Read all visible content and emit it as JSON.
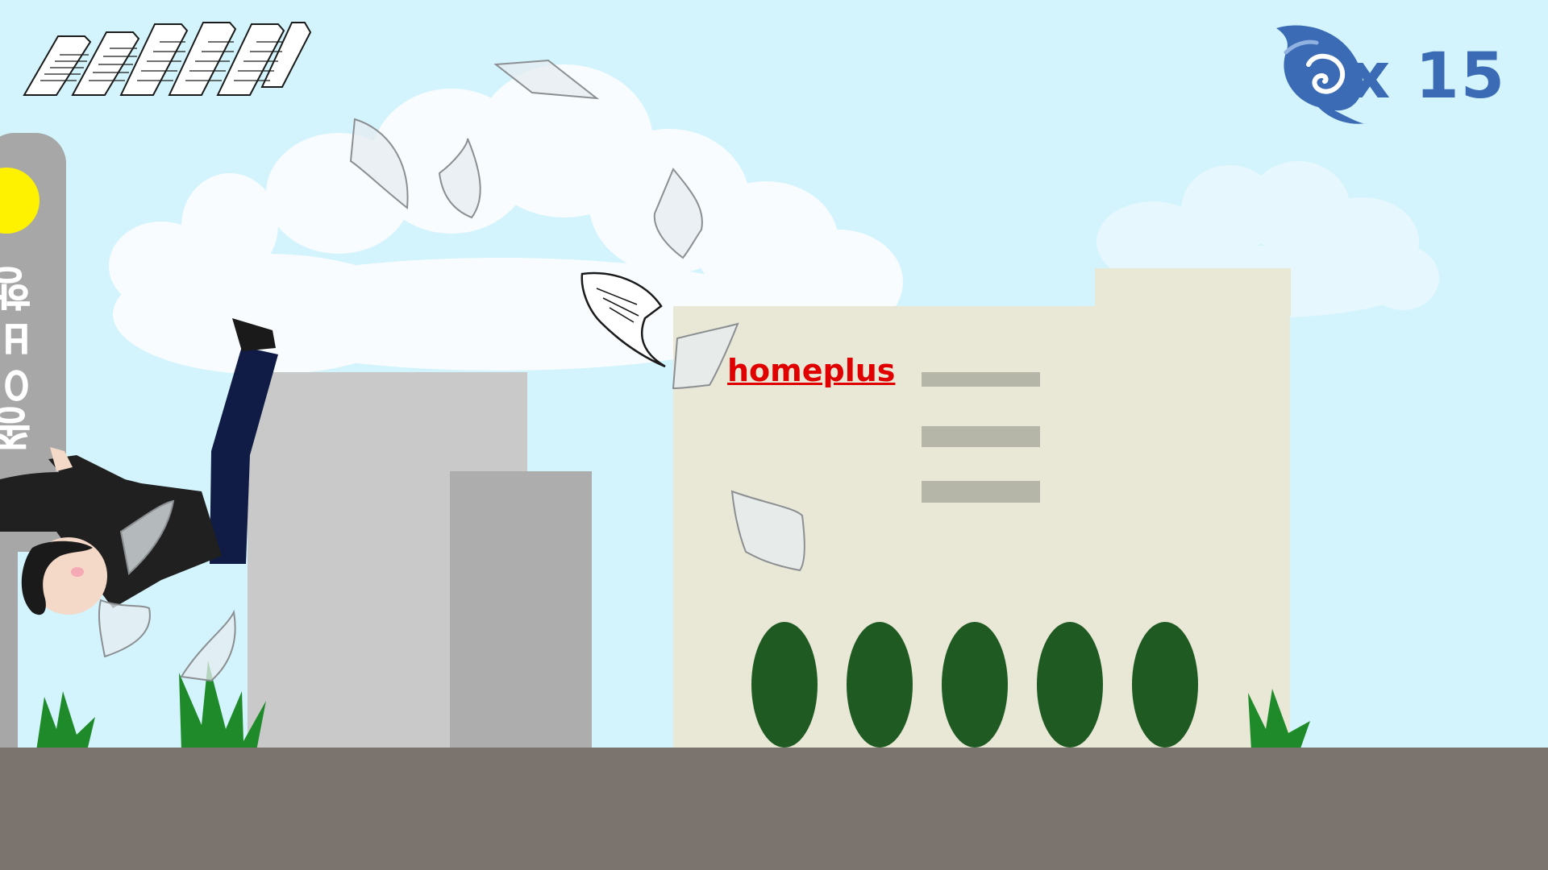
{
  "hud": {
    "paper_stack_icon": "paper-stack-icon",
    "wind_icon": "wind-swirl-icon",
    "wind_count": "x 15",
    "accent_color": "#3a6bb4"
  },
  "scene": {
    "store_sign": "homeplus",
    "store_sign_color": "#e00000",
    "side_sign": "종이비행",
    "sky_color": "#d3f4fd",
    "ground_color": "#7b736e"
  }
}
